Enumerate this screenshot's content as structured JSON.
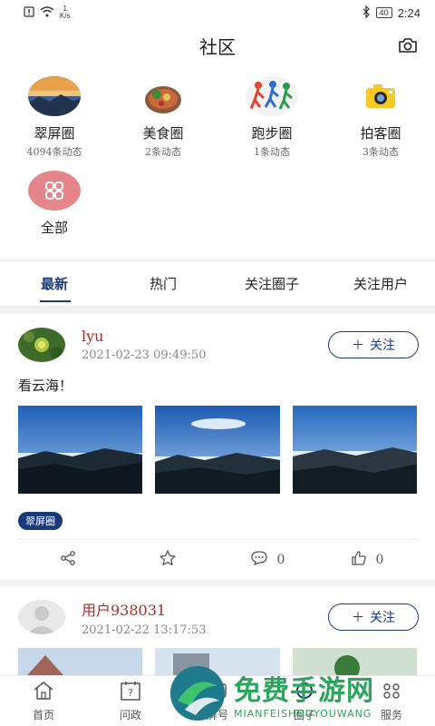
{
  "status_bar": {
    "net_speed_value": "1",
    "net_speed_unit": "K/s",
    "battery": "40",
    "time": "2:24"
  },
  "header": {
    "title": "社区"
  },
  "circles": [
    {
      "name": "翠屏圈",
      "count": "4094条动态"
    },
    {
      "name": "美食圈",
      "count": "2条动态"
    },
    {
      "name": "跑步圈",
      "count": "1条动态"
    },
    {
      "name": "拍客圈",
      "count": "3条动态"
    },
    {
      "name": "全部",
      "count": ""
    }
  ],
  "tabs": [
    "最新",
    "热门",
    "关注圈子",
    "关注用户"
  ],
  "posts": [
    {
      "author": "lyu",
      "time": "2021-02-23 09:49:50",
      "text": "看云海！",
      "tag": "翠屏圈",
      "comments": "0",
      "likes": "0",
      "follow": "关注"
    },
    {
      "author": "用户938031",
      "time": "2021-02-22 13:17:53",
      "follow": "关注"
    }
  ],
  "bottom_nav": [
    "首页",
    "问政",
    "屏号",
    "圈子",
    "服务"
  ],
  "watermark": {
    "title": "免费手游网",
    "subtitle": "MIANFEISHOUYOUWANG"
  }
}
